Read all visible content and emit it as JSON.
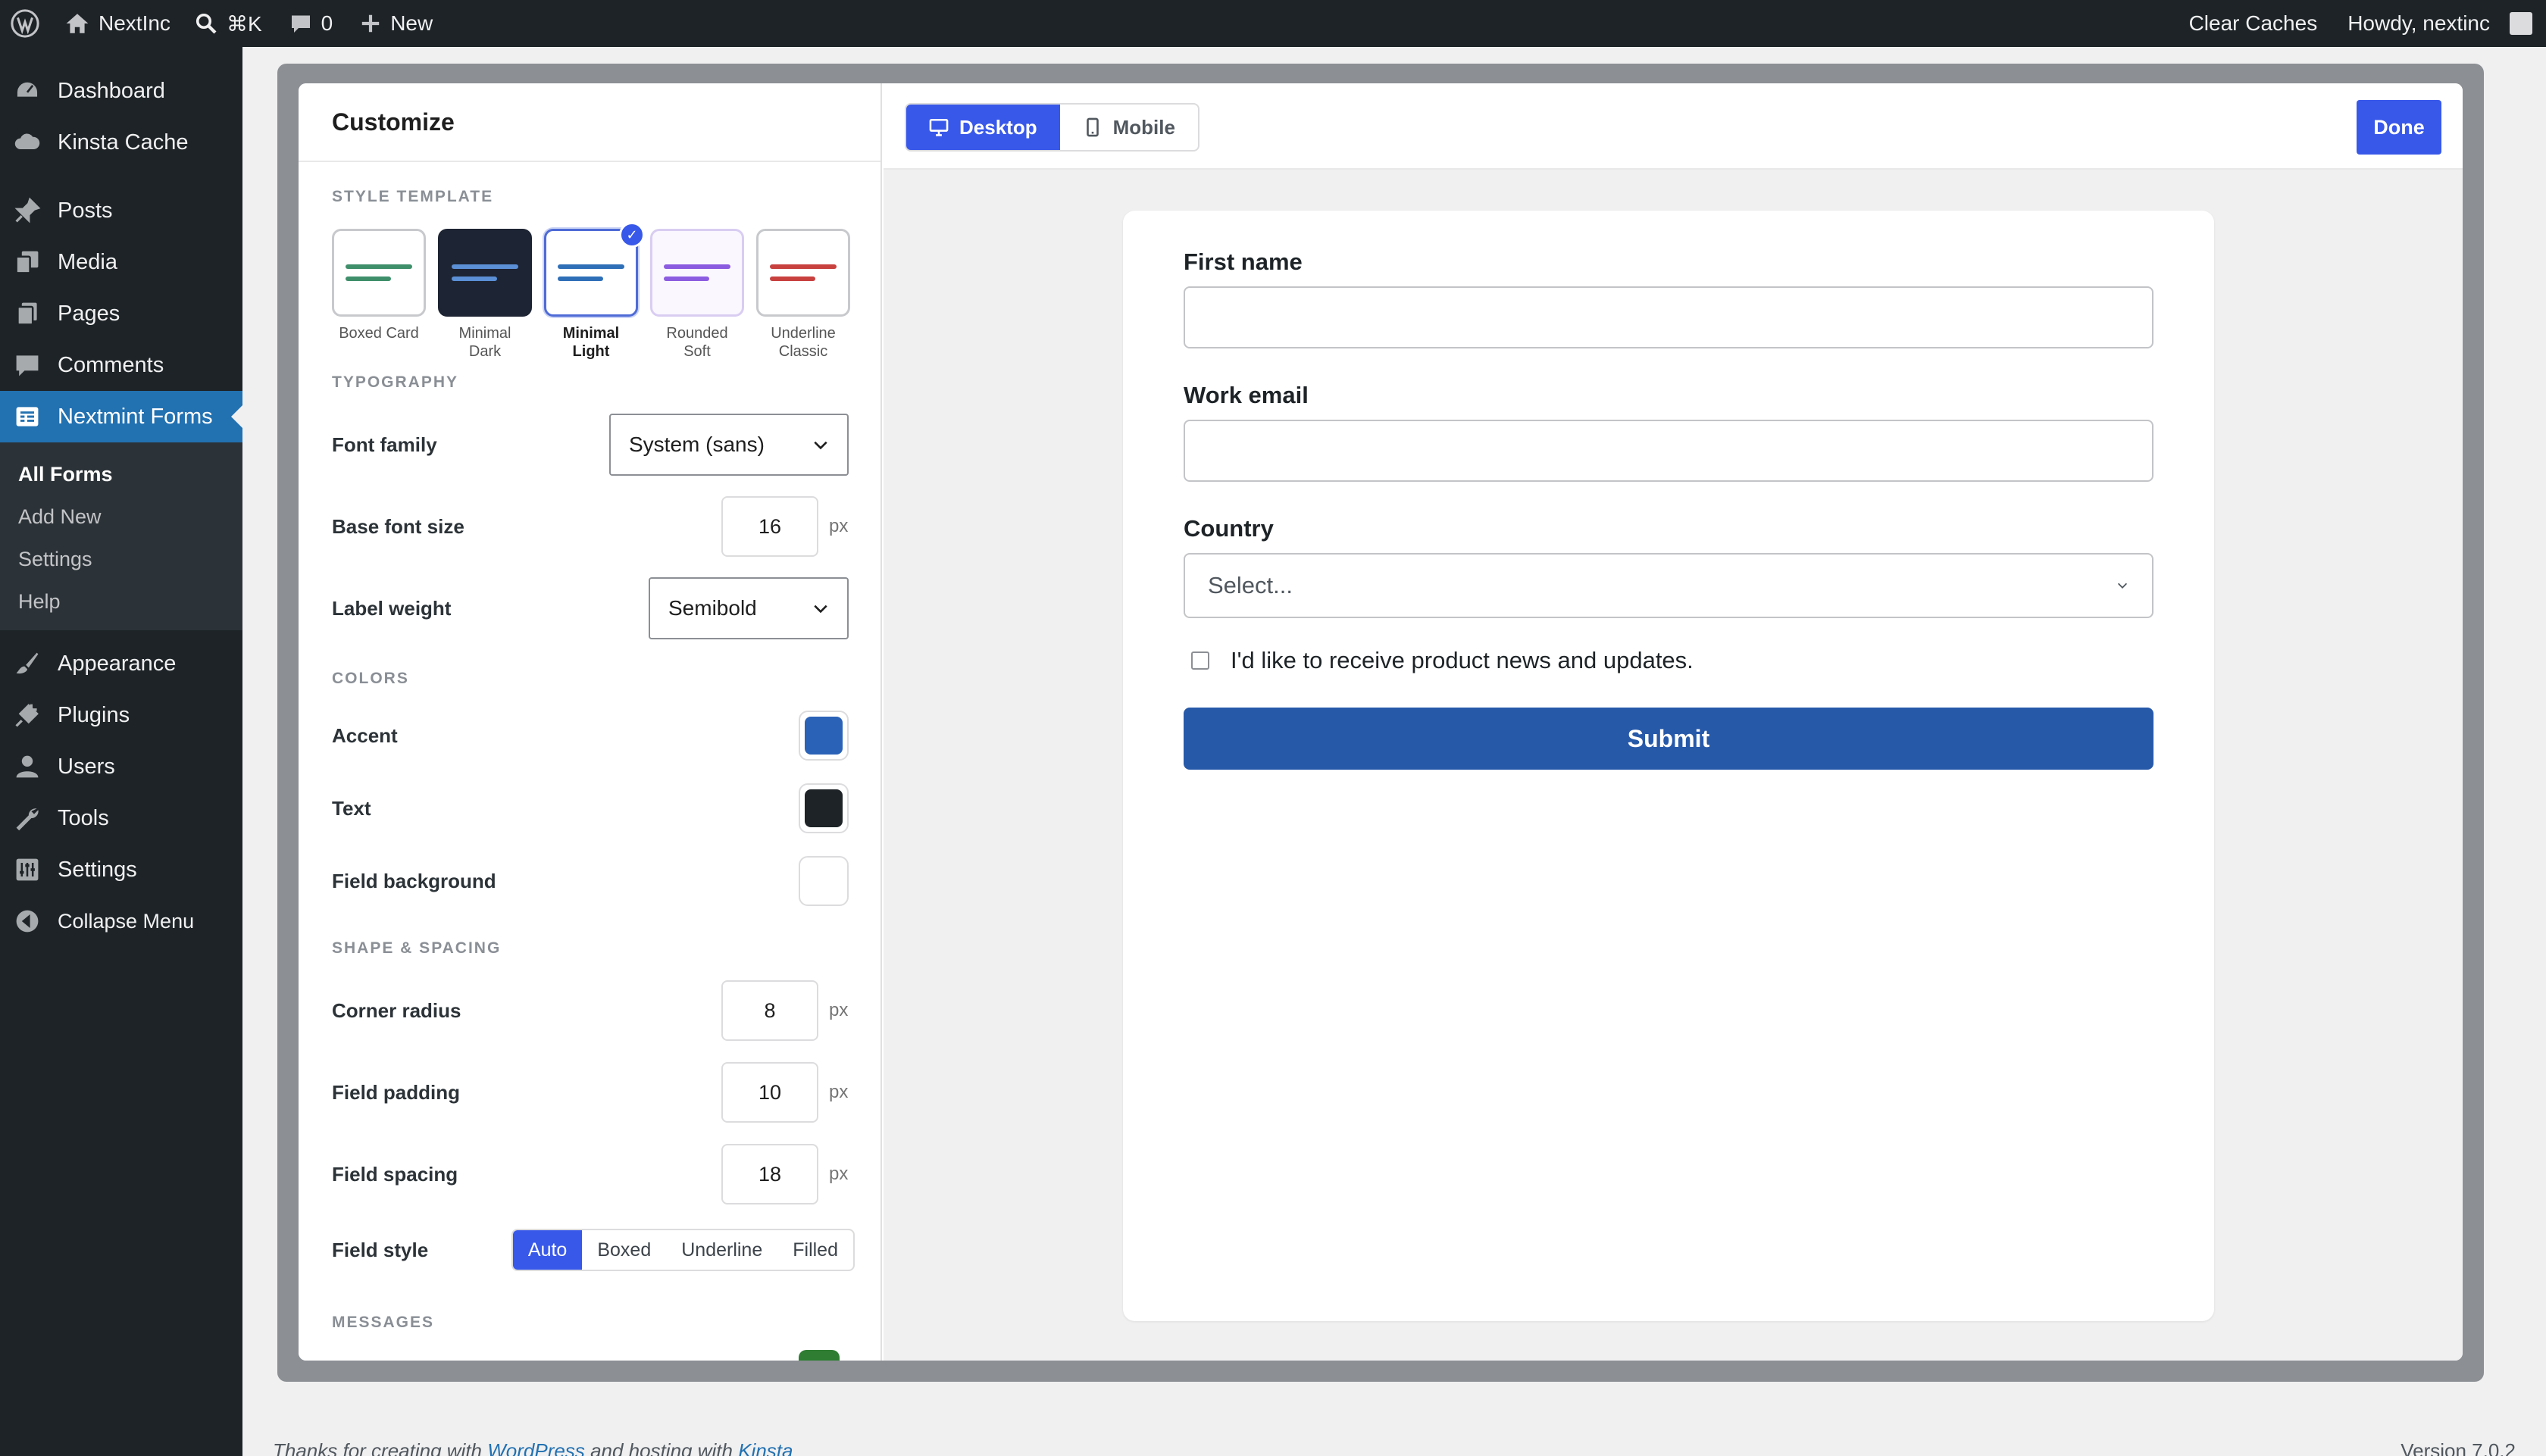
{
  "adminbar": {
    "site_name": "NextInc",
    "search_shortcut": "⌘K",
    "comments_count": "0",
    "new_label": "New",
    "clear_caches": "Clear Caches",
    "howdy": "Howdy, nextinc"
  },
  "sidebar": {
    "items": [
      {
        "label": "Dashboard",
        "icon": "dashboard-icon"
      },
      {
        "label": "Kinsta Cache",
        "icon": "cloud-icon"
      },
      {
        "label": "Posts",
        "icon": "pin-icon"
      },
      {
        "label": "Media",
        "icon": "media-icon"
      },
      {
        "label": "Pages",
        "icon": "pages-icon"
      },
      {
        "label": "Comments",
        "icon": "comment-icon"
      },
      {
        "label": "Nextmint Forms",
        "icon": "forms-icon"
      },
      {
        "label": "Appearance",
        "icon": "brush-icon"
      },
      {
        "label": "Plugins",
        "icon": "plugin-icon"
      },
      {
        "label": "Users",
        "icon": "user-icon"
      },
      {
        "label": "Tools",
        "icon": "wrench-icon"
      },
      {
        "label": "Settings",
        "icon": "settings-icon"
      },
      {
        "label": "Collapse Menu",
        "icon": "collapse-icon"
      }
    ],
    "submenu": [
      "All Forms",
      "Add New",
      "Settings",
      "Help"
    ]
  },
  "panel": {
    "title": "Customize",
    "sections": {
      "style_template": "STYLE TEMPLATE",
      "typography": "TYPOGRAPHY",
      "colors": "COLORS",
      "shape": "SHAPE & SPACING",
      "messages": "MESSAGES"
    },
    "templates": [
      {
        "label1": "Boxed Card",
        "label2": "",
        "line": "#3f8f6b",
        "bg": "#ffffff"
      },
      {
        "label1": "Minimal",
        "label2": "Dark",
        "line": "#5b8fd6",
        "bg": "#1d2433"
      },
      {
        "label1": "Minimal",
        "label2": "Light",
        "line": "#2f6fb8",
        "bg": "#ffffff"
      },
      {
        "label1": "Rounded",
        "label2": "Soft",
        "line": "#8c5ce0",
        "bg": "#faf7ff"
      },
      {
        "label1": "Underline",
        "label2": "Classic",
        "line": "#c8413f",
        "bg": "#ffffff"
      }
    ],
    "font_family_label": "Font family",
    "font_family_value": "System (sans)",
    "base_font_label": "Base font size",
    "base_font_value": "16",
    "label_weight_label": "Label weight",
    "label_weight_value": "Semibold",
    "unit": "px",
    "accent_label": "Accent",
    "accent_color": "#2a62b8",
    "text_label": "Text",
    "text_color": "#1d2327",
    "field_bg_label": "Field background",
    "field_bg_color": "#ffffff",
    "corner_radius_label": "Corner radius",
    "corner_radius_value": "8",
    "field_padding_label": "Field padding",
    "field_padding_value": "10",
    "field_spacing_label": "Field spacing",
    "field_spacing_value": "18",
    "field_style_label": "Field style",
    "field_style_options": [
      "Auto",
      "Boxed",
      "Underline",
      "Filled"
    ],
    "success_color": "#2e7d32"
  },
  "preview": {
    "desktop": "Desktop",
    "mobile": "Mobile",
    "done": "Done",
    "first_name": "First name",
    "work_email": "Work email",
    "country": "Country",
    "country_placeholder": "Select...",
    "consent": "I'd like to receive product news and updates.",
    "submit": "Submit"
  },
  "footer": {
    "thanks_prefix": "Thanks for creating with",
    "wordpress": "WordPress",
    "and_hosting": "and hosting with",
    "kinsta": "Kinsta",
    "version": "Version 7.0.2"
  }
}
